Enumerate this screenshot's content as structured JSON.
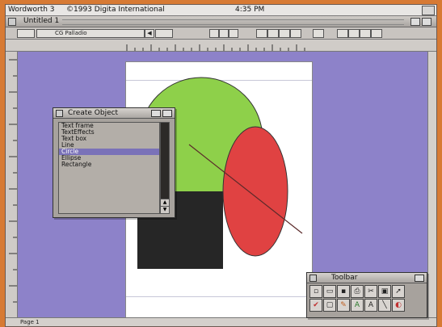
{
  "menubar": {
    "app_title": "Wordworth 3",
    "copyright": "©1993 Digita International",
    "clock": "4:35 PM"
  },
  "window": {
    "title": "Untitled 1"
  },
  "toolbar": {
    "font_name": "CG Palladio"
  },
  "create_object_panel": {
    "title": "Create Object",
    "items": [
      "Text frame",
      "TextEffects",
      "Text box",
      "Line",
      "Circle",
      "Ellipse",
      "Rectangle"
    ],
    "selected_index": 4
  },
  "toolbar_panel": {
    "title": "Toolbar"
  },
  "status": {
    "page_label": "Page 1"
  },
  "colors": {
    "desktop": "#8d82c9",
    "circle": "#8ed04a",
    "ellipse": "#e04242",
    "rectangle": "#262626"
  }
}
